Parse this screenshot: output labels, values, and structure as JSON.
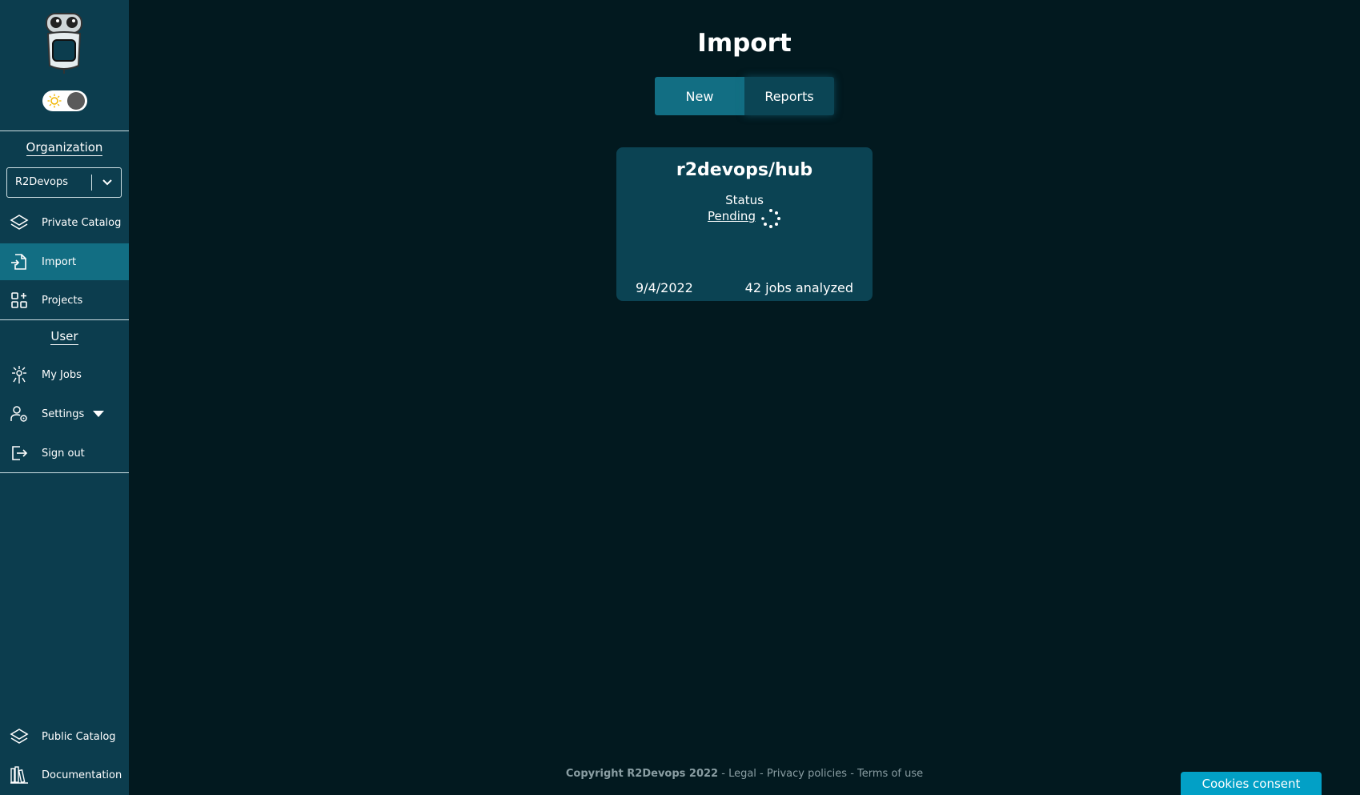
{
  "sidebar": {
    "logo_icon": "robot-logo-icon",
    "theme_toggle": {
      "icon": "sun-icon",
      "state": "dark"
    },
    "organization": {
      "label": "Organization",
      "selected": "R2Devops"
    },
    "org_items": [
      {
        "label": "Private Catalog",
        "icon": "layers-icon"
      },
      {
        "label": "Import",
        "icon": "file-import-icon",
        "active": true
      },
      {
        "label": "Projects",
        "icon": "grid-plus-icon"
      }
    ],
    "user": {
      "label": "User"
    },
    "user_items": [
      {
        "label": "My Jobs",
        "icon": "jobs-icon"
      },
      {
        "label": "Settings",
        "icon": "user-gear-icon"
      },
      {
        "label": "Sign out",
        "icon": "sign-out-icon"
      }
    ],
    "bottom_items": [
      {
        "label": "Public Catalog",
        "icon": "layers-icon"
      },
      {
        "label": "Documentation",
        "icon": "books-icon"
      }
    ]
  },
  "main": {
    "title": "Import",
    "tabs": [
      {
        "label": "New",
        "active": true
      },
      {
        "label": "Reports",
        "active": false
      }
    ],
    "card": {
      "repo": "r2devops/hub",
      "status_label": "Status",
      "status_value": "Pending",
      "date": "9/4/2022",
      "jobs": "42 jobs analyzed"
    }
  },
  "footer": {
    "copyright": "Copyright R2Devops 2022",
    "links": [
      "Legal",
      "Privacy policies",
      "Terms of use"
    ],
    "separator": " - "
  },
  "cookies_button": "Cookies consent",
  "colors": {
    "background": "#02191f",
    "sidebar": "#0c3d4e",
    "accent": "#126e83",
    "card": "#0b4353",
    "cookies": "#02a0c6"
  }
}
